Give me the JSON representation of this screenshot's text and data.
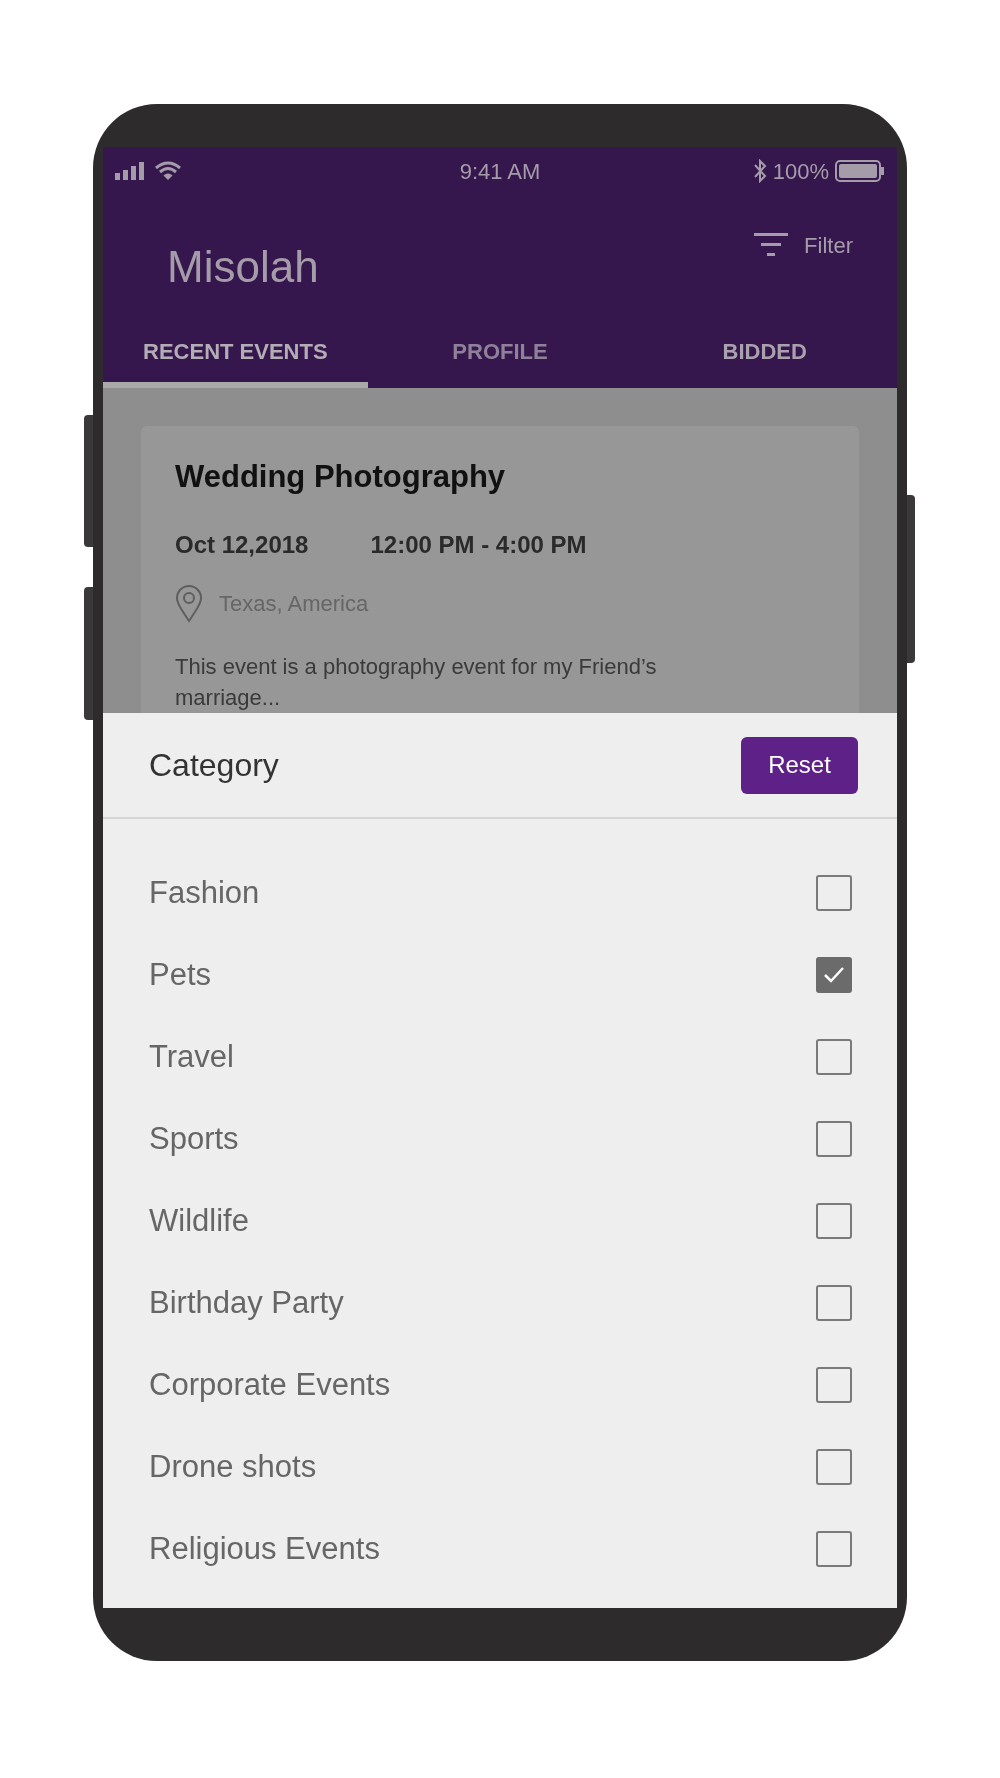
{
  "status_bar": {
    "time": "9:41 AM",
    "battery": "100%"
  },
  "app_bar": {
    "title": "Misolah",
    "filter": "Filter"
  },
  "tabs": [
    {
      "label": "RECENT EVENTS",
      "selected": true
    },
    {
      "label": "PROFILE",
      "selected": false
    },
    {
      "label": "BIDDED",
      "selected": false
    }
  ],
  "event_card": {
    "title": "Wedding Photography",
    "date": "Oct 12,2018",
    "time": "12:00 PM - 4:00 PM",
    "location": "Texas, America",
    "description": "This event is a photography event for my Friend’s marriage..."
  },
  "filter_sheet": {
    "title": "Category",
    "reset": "Reset",
    "categories": [
      {
        "label": "Fashion",
        "checked": false
      },
      {
        "label": "Pets",
        "checked": true
      },
      {
        "label": "Travel",
        "checked": false
      },
      {
        "label": "Sports",
        "checked": false
      },
      {
        "label": "Wildlife",
        "checked": false
      },
      {
        "label": "Birthday Party",
        "checked": false
      },
      {
        "label": "Corporate Events",
        "checked": false
      },
      {
        "label": "Drone shots",
        "checked": false
      },
      {
        "label": "Religious Events",
        "checked": false
      }
    ]
  }
}
